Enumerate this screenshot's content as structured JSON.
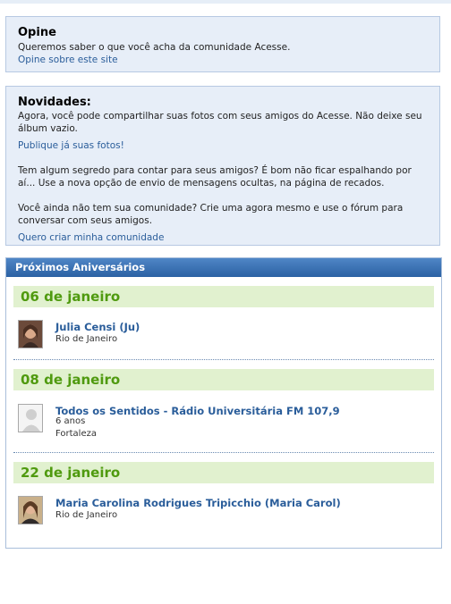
{
  "opine": {
    "title": "Opine",
    "text": "Queremos saber o que você acha da comunidade Acesse.",
    "link": "Opine sobre este site"
  },
  "novidades": {
    "title": "Novidades:",
    "p1": "Agora, você pode compartilhar suas fotos com seus amigos do Acesse. Não deixe seu álbum vazio.",
    "p1_link": "Publique já suas fotos!",
    "p2": "Tem algum segredo para contar para seus amigos? É bom não ficar espalhando por aí... Use a nova opção de envio de mensagens ocultas, na página de recados.",
    "p3": "Você ainda não tem sua comunidade? Crie uma agora mesmo e use o fórum para conversar com seus amigos.",
    "p3_link": "Quero criar minha comunidade"
  },
  "aniversarios": {
    "header": "Próximos Aniversários",
    "groups": [
      {
        "date": "06 de janeiro",
        "people": [
          {
            "name": "Julia Censi (Ju)",
            "lines": [
              "Rio de Janeiro"
            ],
            "avatar": "photo-avatar"
          }
        ]
      },
      {
        "date": "08 de janeiro",
        "people": [
          {
            "name": "Todos os Sentidos - Rádio Universitária FM 107,9",
            "lines": [
              "6 anos",
              "Fortaleza"
            ],
            "avatar": "default-user-avatar"
          }
        ]
      },
      {
        "date": "22 de janeiro",
        "people": [
          {
            "name": "Maria Carolina Rodrigues Tripicchio (Maria Carol)",
            "lines": [
              "Rio de Janeiro"
            ],
            "avatar": "photo-avatar"
          }
        ]
      }
    ]
  },
  "colors": {
    "link": "#2a5d9a",
    "date_text": "#4f9a0f",
    "date_bg": "#e1f1cf",
    "box_bg": "#e7eef8",
    "header_bg": "#2b61a3"
  }
}
